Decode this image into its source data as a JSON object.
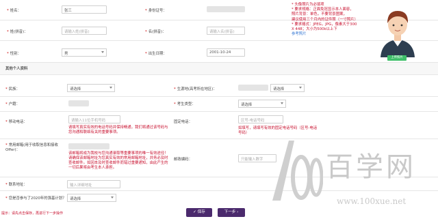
{
  "fields": {
    "name": {
      "label": "姓名：",
      "value": "张三"
    },
    "id_no": {
      "label": "身份证号："
    },
    "surname": {
      "label": "姓(拼音)：",
      "placeholder": "请输入姓(拼音)"
    },
    "given": {
      "label": "名(拼音)：",
      "placeholder": "请输入名(拼音)"
    },
    "gender": {
      "label": "性别：",
      "value": "男"
    },
    "birth": {
      "label": "出生日期：",
      "value": "2001-10-24"
    }
  },
  "photo": {
    "notes": [
      "* 头像照片为必填项",
      "* 要求规格：正面免冠显示本人面容，",
      "照片背景：单色，不要背景图案，",
      "建议使用三个月内的证件照（一寸照片）",
      "* 要求格式：JPEG，JPG，像素大于300",
      "X 448；大小为500k以上下"
    ],
    "ref_link": "参考照片",
    "upload_label": "上传照片"
  },
  "section_title": "其他个人资料",
  "other": {
    "nation": {
      "label": "民族：",
      "value": "请选择"
    },
    "residence": {
      "label": "生源地(高考所在地区)：",
      "value": "请选择"
    },
    "hukou": {
      "label": "户籍："
    },
    "candidate_type": {
      "label": "考生类型：",
      "value": "请选择"
    },
    "mobile": {
      "label": "移动电话：",
      "placeholder": "请输入11位手机号码",
      "note": "请填写真实有效的电话号码并保持畅通，我们将通过该号码与您沟通和联络有关的重要事项。"
    },
    "landline": {
      "label": "固定电话：",
      "placeholder": "区号-电话号码",
      "note": "如填写，请填写有效的固定电话号码（区号-电话号码）"
    },
    "email": {
      "label": "常用邮箱(用于收取信息和接收Offer)：",
      "note": "该邮箱将成为我校与您沟通录取等重要事项的唯一有效途径！请确保该邮箱地址为您真实有效的常用邮箱地址，并务必及时查收邮件。如因本及时查收邮件而错过重要通知，由此产生的一切后果将由考生本人承担。"
    },
    "postcode": {
      "label": "邮政编码：",
      "placeholder": "只能输入数字"
    },
    "address": {
      "label": "联系地址：",
      "placeholder": "输入详细地址"
    },
    "plan": {
      "label": "您是否参与了2020年的强基计划？",
      "value": "请选择"
    }
  },
  "footer": {
    "hint": "提示：请先点击保存，再进行下一步操作",
    "save_label": "✓ 保存",
    "next_label": "下一步 ›"
  },
  "watermark": {
    "number": "100",
    "chars": "百学网",
    "url": "www.100xue.net"
  },
  "colors": {
    "accent": "#4b2a6d",
    "warning": "#c8102e",
    "upload": "#3fbf6a"
  }
}
